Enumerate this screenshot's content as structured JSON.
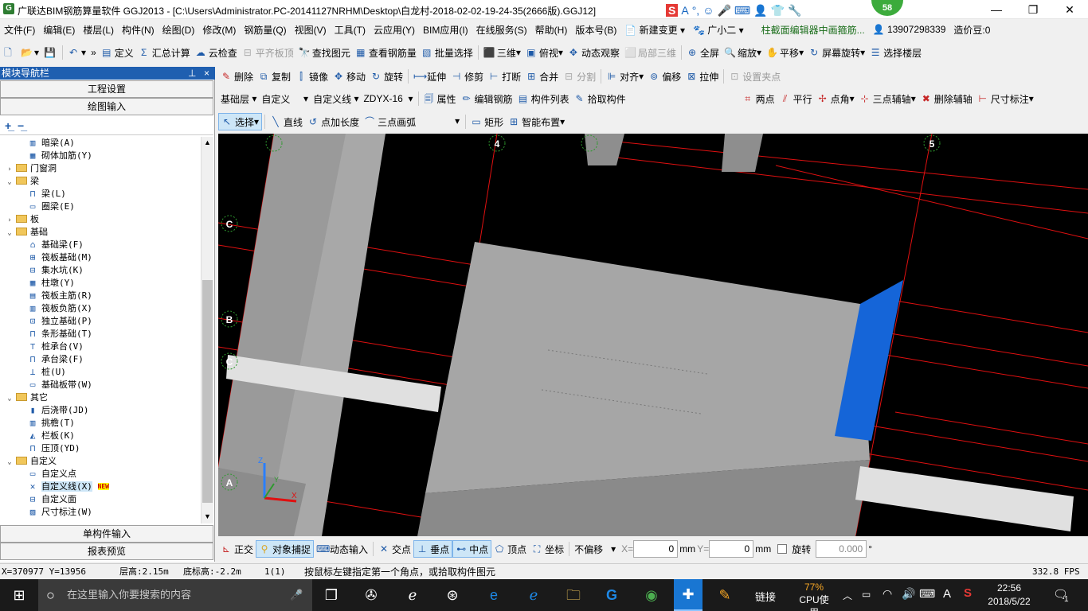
{
  "titlebar": {
    "title": "广联达BIM钢筋算量软件 GGJ2013 - [C:\\Users\\Administrator.PC-20141127NRHM\\Desktop\\白龙村-2018-02-02-19-24-35(2666版).GGJ12]",
    "badge": "58"
  },
  "menu": [
    "文件(F)",
    "编辑(E)",
    "楼层(L)",
    "构件(N)",
    "绘图(D)",
    "修改(M)",
    "钢筋量(Q)",
    "视图(V)",
    "工具(T)",
    "云应用(Y)",
    "BIM应用(I)",
    "在线服务(S)",
    "帮助(H)",
    "版本号(B)",
    "新建变更",
    "广小二",
    "柱截面编辑器中画箍筋...",
    "13907298339",
    "造价豆:0"
  ],
  "toolbar1": [
    "定义",
    "汇总计算",
    "云检查",
    "平齐板顶",
    "查找图元",
    "查看钢筋量",
    "批量选择",
    "三维",
    "俯视",
    "动态观察",
    "局部三维",
    "全屏",
    "缩放",
    "平移",
    "屏幕旋转",
    "选择楼层"
  ],
  "toolbar2": [
    "删除",
    "复制",
    "镜像",
    "移动",
    "旋转",
    "延伸",
    "修剪",
    "打断",
    "合并",
    "分割",
    "对齐",
    "偏移",
    "拉伸",
    "设置夹点"
  ],
  "toolbar3": {
    "floor": "基础层",
    "category": "自定义",
    "type": "自定义线",
    "component": "ZDYX-16",
    "items": [
      "属性",
      "编辑钢筋",
      "构件列表",
      "拾取构件"
    ],
    "right": [
      "两点",
      "平行",
      "点角",
      "三点辅轴",
      "删除辅轴",
      "尺寸标注"
    ]
  },
  "toolbar4": [
    "选择",
    "直线",
    "点加长度",
    "三点画弧",
    "矩形",
    "智能布置"
  ],
  "nav": {
    "header": "模块导航栏",
    "pin": "⊥",
    "close": "×",
    "btn_engineering": "工程设置",
    "btn_drawing": "绘图输入",
    "btn_single": "单构件输入",
    "btn_report": "报表预览",
    "tree": [
      {
        "level": 2,
        "type": "leaf",
        "label": "暗梁(A)"
      },
      {
        "level": 2,
        "type": "leaf",
        "label": "砌体加筋(Y)"
      },
      {
        "level": 1,
        "type": "folder",
        "tog": "›",
        "label": "门窗洞"
      },
      {
        "level": 1,
        "type": "folder",
        "tog": "⌄",
        "label": "梁"
      },
      {
        "level": 2,
        "type": "leaf",
        "label": "梁(L)"
      },
      {
        "level": 2,
        "type": "leaf",
        "label": "圈梁(E)"
      },
      {
        "level": 1,
        "type": "folder",
        "tog": "›",
        "label": "板"
      },
      {
        "level": 1,
        "type": "folder",
        "tog": "⌄",
        "label": "基础"
      },
      {
        "level": 2,
        "type": "leaf",
        "label": "基础梁(F)"
      },
      {
        "level": 2,
        "type": "leaf",
        "label": "筏板基础(M)"
      },
      {
        "level": 2,
        "type": "leaf",
        "label": "集水坑(K)"
      },
      {
        "level": 2,
        "type": "leaf",
        "label": "柱墩(Y)"
      },
      {
        "level": 2,
        "type": "leaf",
        "label": "筏板主筋(R)"
      },
      {
        "level": 2,
        "type": "leaf",
        "label": "筏板负筋(X)"
      },
      {
        "level": 2,
        "type": "leaf",
        "label": "独立基础(P)"
      },
      {
        "level": 2,
        "type": "leaf",
        "label": "条形基础(T)"
      },
      {
        "level": 2,
        "type": "leaf",
        "label": "桩承台(V)"
      },
      {
        "level": 2,
        "type": "leaf",
        "label": "承台梁(F)"
      },
      {
        "level": 2,
        "type": "leaf",
        "label": "桩(U)"
      },
      {
        "level": 2,
        "type": "leaf",
        "label": "基础板带(W)"
      },
      {
        "level": 1,
        "type": "folder",
        "tog": "⌄",
        "label": "其它"
      },
      {
        "level": 2,
        "type": "leaf",
        "label": "后浇带(JD)"
      },
      {
        "level": 2,
        "type": "leaf",
        "label": "挑檐(T)"
      },
      {
        "level": 2,
        "type": "leaf",
        "label": "栏板(K)"
      },
      {
        "level": 2,
        "type": "leaf",
        "label": "压顶(YD)"
      },
      {
        "level": 1,
        "type": "folder",
        "tog": "⌄",
        "label": "自定义"
      },
      {
        "level": 2,
        "type": "leaf",
        "label": "自定义点"
      },
      {
        "level": 2,
        "type": "leaf",
        "label": "自定义线(X)",
        "selected": true,
        "badge": "NEW"
      },
      {
        "level": 2,
        "type": "leaf",
        "label": "自定义面"
      },
      {
        "level": 2,
        "type": "leaf",
        "label": "尺寸标注(W)"
      }
    ]
  },
  "viewport": {
    "axes": [
      "4",
      "5",
      "C",
      "B",
      "C",
      "A"
    ],
    "axis_color": "#e01010",
    "member_color": "#9e9e9e",
    "highlight_color": "#1565d8"
  },
  "bottom_toolbar": {
    "items": [
      "正交",
      "对象捕捉",
      "动态输入",
      "交点",
      "垂点",
      "中点",
      "顶点",
      "坐标"
    ],
    "offset_mode": "不偏移",
    "x_label": "X=",
    "x_value": "0",
    "x_unit": "mm",
    "y_label": "Y=",
    "y_value": "0",
    "y_unit": "mm",
    "rotate_label": "旋转",
    "rotate_value": "0.000",
    "rotate_unit": "°"
  },
  "status": {
    "coords": "X=370977 Y=13956",
    "floor_height": "层高:2.15m",
    "bottom_elev": "底标高:-2.2m",
    "count": "1(1)",
    "hint": "按鼠标左键指定第一个角点，或拾取构件图元",
    "fps": "332.8 FPS"
  },
  "taskbar": {
    "search_placeholder": "在这里输入你要搜索的内容",
    "link": "链接",
    "cpu_pct": "77%",
    "cpu_label": "CPU使用",
    "time": "22:56",
    "date": "2018/5/22",
    "notif": "1"
  }
}
